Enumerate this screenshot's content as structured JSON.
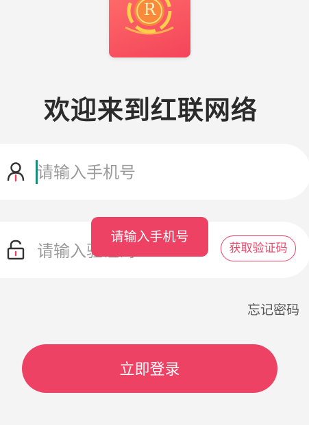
{
  "app": {
    "logo_letter": "R",
    "welcome_title": "欢迎来到红联网络"
  },
  "form": {
    "phone_placeholder": "请输入手机号",
    "code_placeholder": "请输入验证码",
    "get_code_label": "获取验证码",
    "forgot_password_label": "忘记密码",
    "login_label": "立即登录"
  },
  "toast": {
    "message": "请输入手机号"
  },
  "icons": {
    "phone_field": "user-icon",
    "code_field": "unlock-icon"
  },
  "colors": {
    "accent": "#ee4264",
    "background": "#f4f4f4",
    "cursor": "#1a8c7a"
  }
}
